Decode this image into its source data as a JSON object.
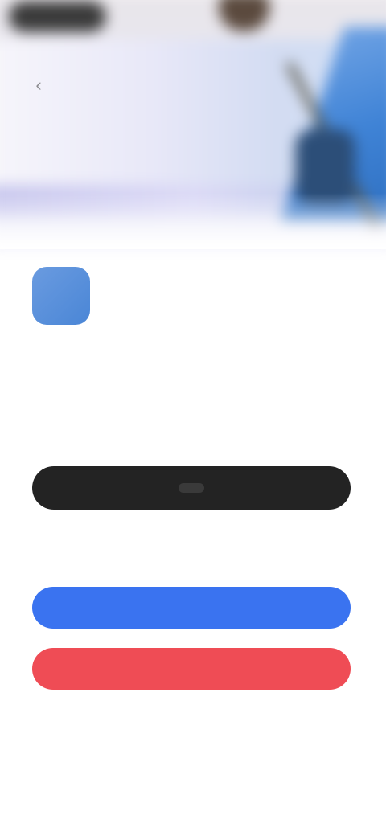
{
  "header": {
    "back_icon": "chevron-left-icon"
  },
  "app": {
    "icon": "app-icon",
    "accent_color": "#4a86d6",
    "title": "",
    "description": ""
  },
  "actions": {
    "primary_label": "",
    "secondary_label": "",
    "blue_label": "",
    "red_label": "",
    "primary_color": "#232323",
    "blue_color": "#3a73f0",
    "red_color": "#ef4c55"
  },
  "footer": {
    "text": ""
  }
}
